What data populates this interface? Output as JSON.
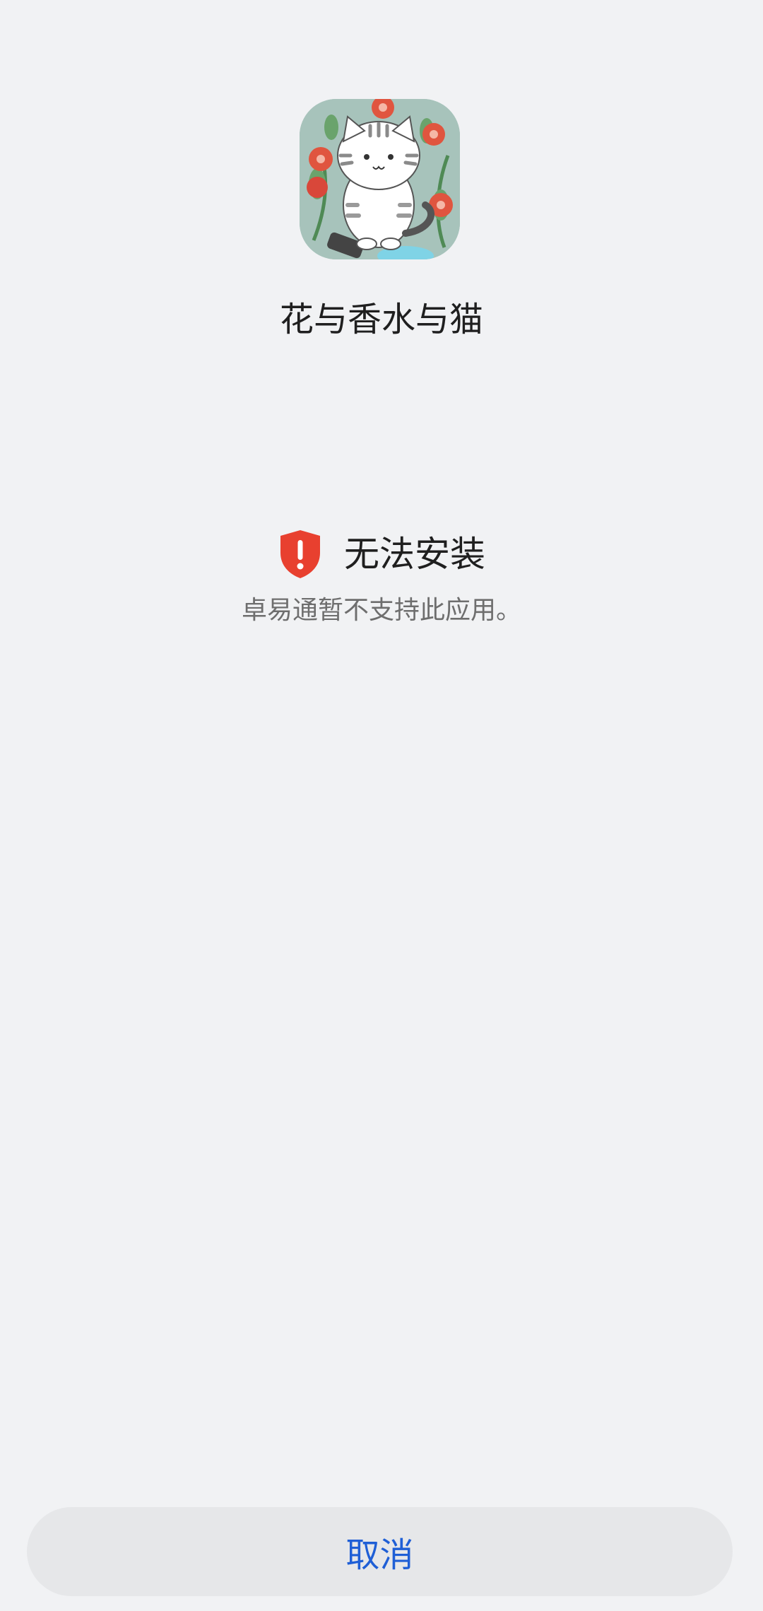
{
  "app": {
    "name": "花与香水与猫",
    "icon": "cat-and-flowers-app-icon"
  },
  "status": {
    "icon": "shield-warning-icon",
    "title": "无法安装",
    "message": "卓易通暂不支持此应用。"
  },
  "actions": {
    "cancel_label": "取消"
  },
  "colors": {
    "background": "#f1f2f4",
    "warning": "#e8402f",
    "accent": "#1f5fd6",
    "button_bg": "#e6e7e9"
  }
}
